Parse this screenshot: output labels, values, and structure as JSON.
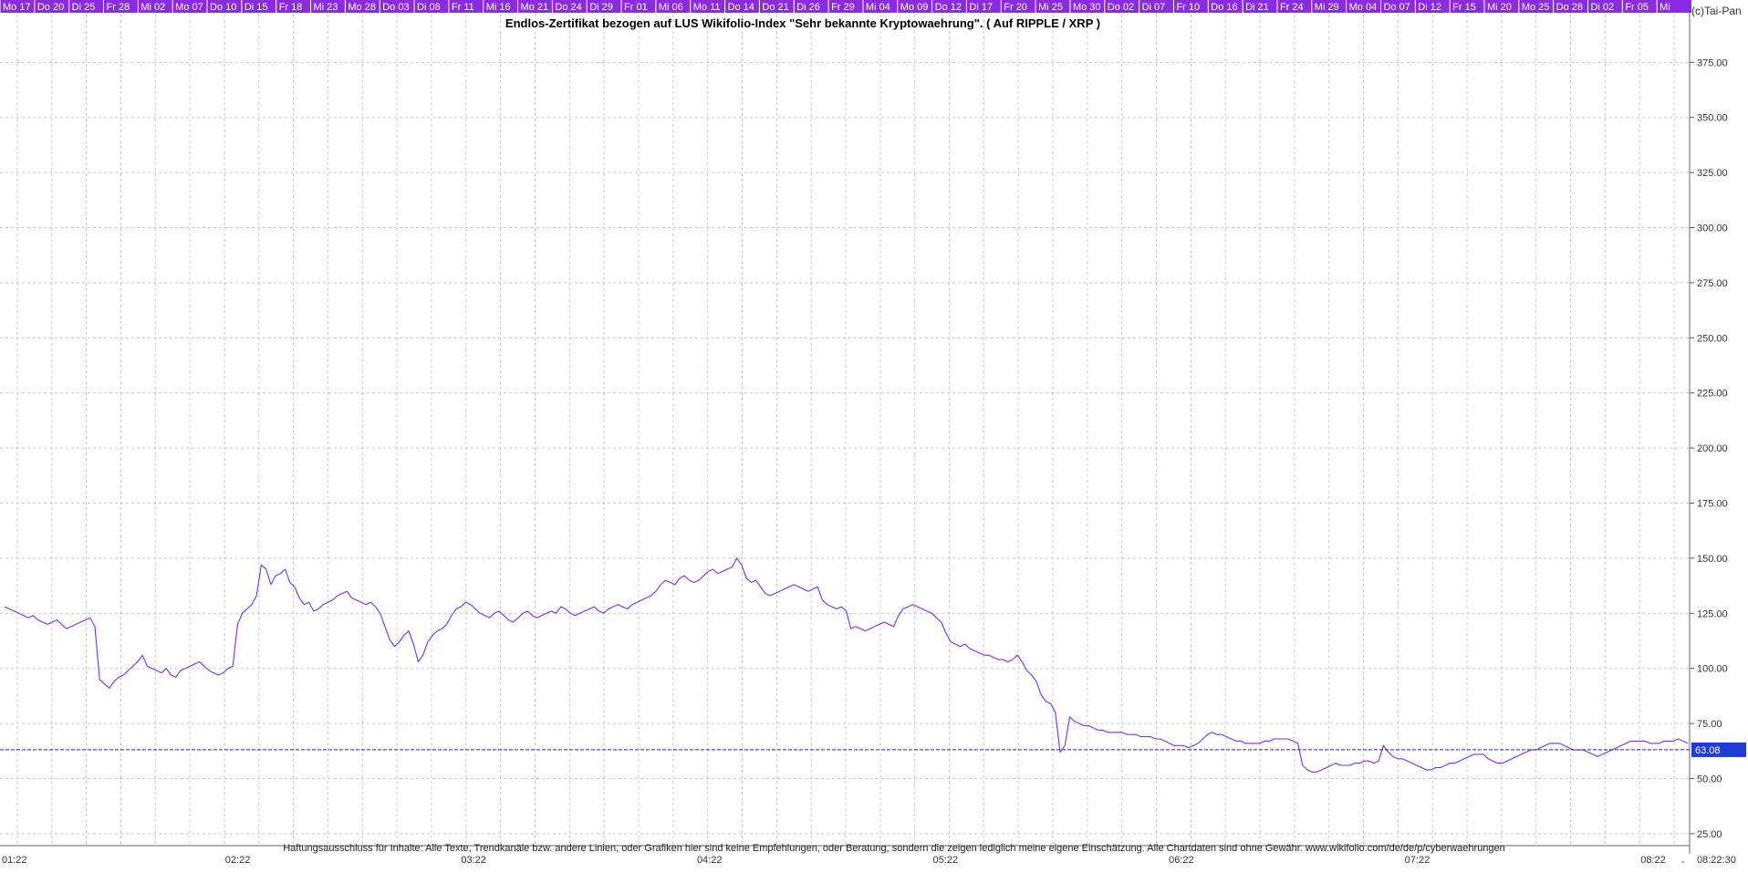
{
  "colors": {
    "line": "#7a2fe8",
    "day_strip_bg": "#8a2be2",
    "day_strip_text": "#ffffff",
    "grid": "#c8c8c8",
    "last_price_line": "#2222cc",
    "last_price_badge": "#1f3cd6",
    "axis_text": "#333333"
  },
  "copyright": "(c)Tai-Pan",
  "day_labels": [
    "Mo 17",
    "Do 20",
    "Di 25",
    "Fr 28",
    "Mi 02",
    "Mo 07",
    "Do 10",
    "Di 15",
    "Fr 18",
    "Mi 23",
    "Mo 28",
    "Do 03",
    "Di 08",
    "Fr 11",
    "Mi 16",
    "Mo 21",
    "Do 24",
    "Di 29",
    "Fr 01",
    "Mi 06",
    "Mo 11",
    "Do 14",
    "Do 21",
    "Di 26",
    "Fr 29",
    "Mi 04",
    "Mo 09",
    "Do 12",
    "Di 17",
    "Fr 20",
    "Mi 25",
    "Mo 30",
    "Do 02",
    "Di 07",
    "Fr 10",
    "Do 16",
    "Di 21",
    "Fr 24",
    "Mi 29",
    "Mo 04",
    "Do 07",
    "Di 12",
    "Fr 15",
    "Mi 20",
    "Mo 25",
    "Do 28",
    "Di 02",
    "Fr 05",
    "Mi"
  ],
  "footer_right": "-",
  "chart_data": {
    "type": "line",
    "title": "Endlos-Zertifikat bezogen auf LUS Wikifolio-Index \"Sehr bekannte Kryptowaehrung\". ( Auf RIPPLE / XRP )",
    "disclaimer": "Haftungsausschluss für Inhalte: Alle Texte, Trendkanäle bzw. andere Linien, oder Grafiken hier sind keine Empfehlungen, oder Beratung, sondern die zeigen lediglich meine eigene Einschätzung. Alle Chartdaten sind ohne Gewähr.  www.wikifolio.com/de/de/p/cyberwaehrungen",
    "x_tick_labels": [
      "01:22",
      "02:22",
      "03:22",
      "04:22",
      "05:22",
      "06:22",
      "07:22",
      "08:22",
      "08:22:30"
    ],
    "y_tick_labels": [
      "375.00",
      "350.00",
      "325.00",
      "300.00",
      "275.00",
      "250.00",
      "225.00",
      "200.00",
      "175.00",
      "150.00",
      "125.00",
      "100.00",
      "75.00",
      "50.00",
      "25.00"
    ],
    "ylim": [
      20,
      395
    ],
    "last_price": 63.08,
    "last_price_label": "63.08",
    "series": [
      {
        "values": [
          128,
          127,
          126,
          125,
          124,
          123,
          124,
          122,
          121,
          120,
          121,
          122,
          120,
          118,
          119,
          120,
          121,
          122,
          123,
          119,
          95,
          93,
          91,
          94,
          96,
          97,
          99,
          101,
          103,
          106,
          101,
          100,
          99,
          98,
          100,
          97,
          96,
          99,
          100,
          101,
          102,
          103,
          101,
          99,
          98,
          97,
          98,
          100,
          101,
          120,
          125,
          127,
          129,
          133,
          147,
          145,
          138,
          142,
          143,
          145,
          139,
          137,
          132,
          129,
          130,
          126,
          127,
          129,
          130,
          131,
          133,
          134,
          135,
          132,
          131,
          130,
          129,
          130,
          128,
          125,
          119,
          113,
          110,
          112,
          115,
          117,
          111,
          103,
          106,
          112,
          115,
          117,
          118,
          120,
          124,
          127,
          128,
          130,
          129,
          127,
          125,
          124,
          123,
          125,
          126,
          124,
          122,
          121,
          123,
          125,
          126,
          124,
          123,
          124,
          125,
          126,
          125,
          128,
          127,
          125,
          124,
          125,
          126,
          127,
          128,
          126,
          125,
          127,
          128,
          129,
          128,
          127,
          129,
          130,
          131,
          132,
          133,
          135,
          138,
          140,
          139,
          138,
          141,
          142,
          140,
          139,
          140,
          142,
          144,
          145,
          143,
          144,
          145,
          146,
          150,
          147,
          141,
          139,
          140,
          137,
          134,
          133,
          134,
          135,
          136,
          137,
          138,
          137,
          136,
          135,
          136,
          137,
          131,
          129,
          128,
          127,
          128,
          126,
          118,
          119,
          118,
          117,
          118,
          119,
          120,
          121,
          120,
          119,
          124,
          127,
          128,
          129,
          128,
          127,
          126,
          125,
          123,
          121,
          116,
          112,
          111,
          110,
          111,
          109,
          108,
          107,
          106,
          106,
          105,
          104,
          104,
          103,
          104,
          106,
          103,
          99,
          97,
          94,
          88,
          85,
          84,
          80,
          62,
          65,
          78,
          76,
          75,
          74,
          74,
          73,
          72,
          72,
          71,
          71,
          71,
          71,
          70,
          70,
          70,
          69,
          69,
          69,
          68,
          68,
          67,
          66,
          65,
          65,
          65,
          64,
          65,
          66,
          68,
          70,
          71,
          70,
          70,
          69,
          68,
          67,
          67,
          66,
          66,
          66,
          66,
          67,
          67,
          68,
          68,
          68,
          68,
          67,
          66,
          56,
          54,
          53,
          53,
          54,
          55,
          56,
          57,
          56,
          56,
          56,
          57,
          57,
          58,
          58,
          57,
          58,
          65,
          62,
          60,
          59,
          59,
          58,
          57,
          56,
          55,
          54,
          54,
          55,
          55,
          56,
          57,
          57,
          58,
          59,
          60,
          61,
          61,
          61,
          59,
          58,
          57,
          57,
          58,
          59,
          60,
          61,
          62,
          63,
          63,
          64,
          65,
          66,
          66,
          66,
          65,
          64,
          63,
          63,
          63,
          62,
          61,
          60,
          61,
          62,
          63,
          64,
          65,
          66,
          67,
          67,
          67,
          67,
          66,
          66,
          66,
          67,
          67,
          67,
          68,
          67,
          66
        ]
      }
    ]
  }
}
